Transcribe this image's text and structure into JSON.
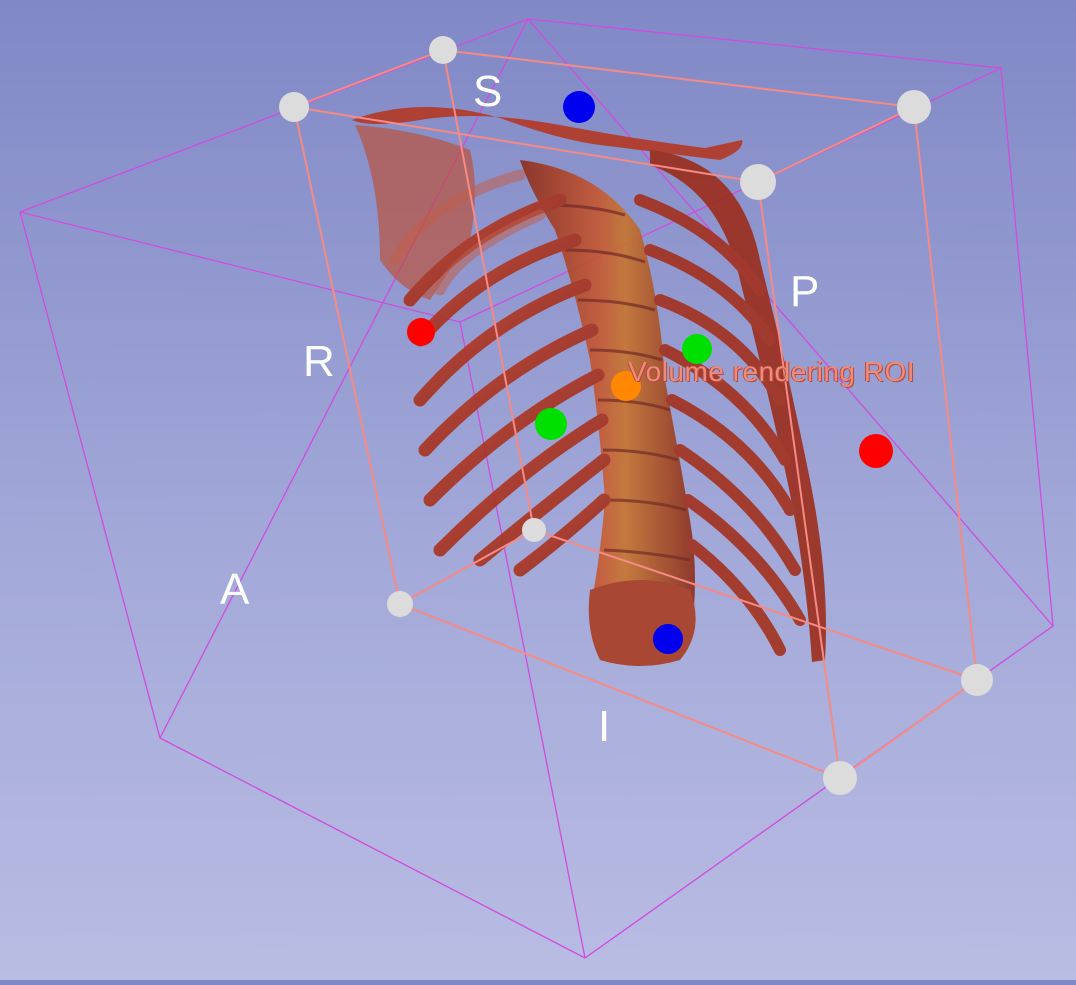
{
  "view": {
    "orientation": {
      "superior": "S",
      "inferior": "I",
      "right": "R",
      "anterior": "A",
      "posterior": "P"
    },
    "roi_label": "Volume rendering ROI",
    "colors": {
      "background_top": "#8088c6",
      "background_bottom": "#b9bce3",
      "outer_box": "#d04be0",
      "roi_box": "#f58a86",
      "corner_handle": "#dcdcdc",
      "handle_lr": "#ff0000",
      "handle_si": "#0000ee",
      "handle_ap": "#00e000",
      "center_handle": "#ff8800",
      "bone": "#b8341c"
    },
    "icons": [
      "roi-corner-handle",
      "roi-face-handle",
      "roi-center-handle"
    ]
  }
}
